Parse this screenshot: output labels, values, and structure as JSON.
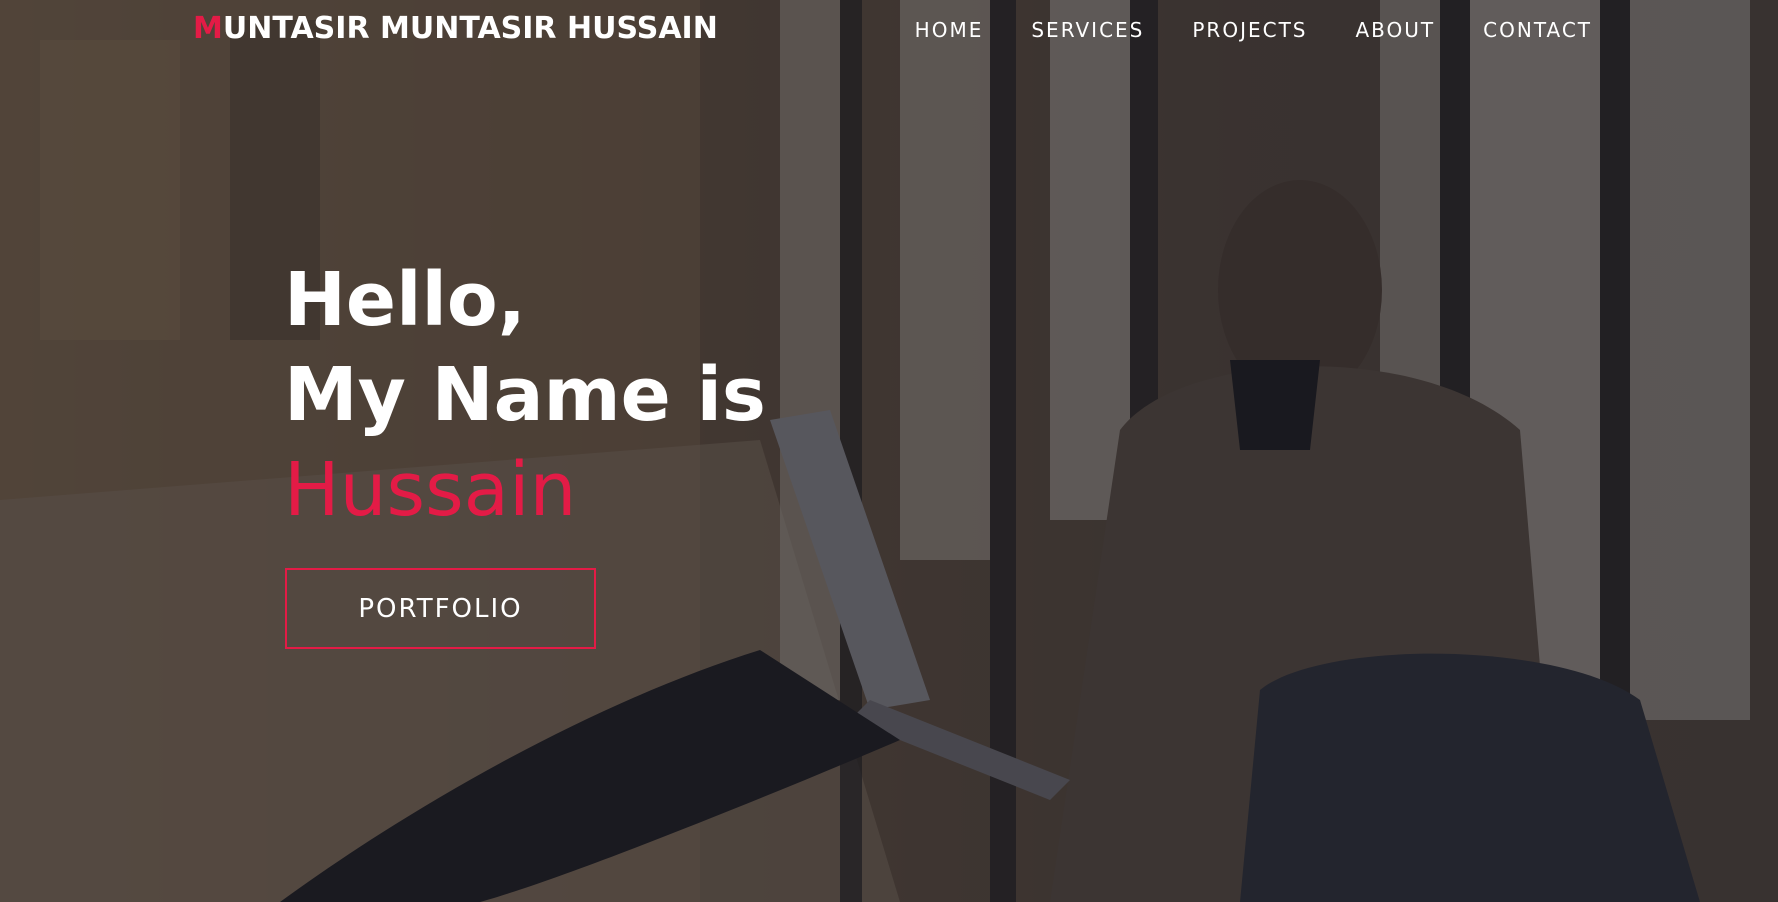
{
  "brand": {
    "first_letter": "M",
    "rest": "UNTASIR MUNTASIR HUSSAIN"
  },
  "nav": {
    "items": [
      {
        "label": "HOME"
      },
      {
        "label": "SERVICES"
      },
      {
        "label": "PROJECTS"
      },
      {
        "label": "ABOUT"
      },
      {
        "label": "CONTACT"
      }
    ]
  },
  "hero": {
    "line1": "Hello,",
    "line2": "My Name is",
    "line3": "Hussain",
    "button_label": "PORTFOLIO"
  },
  "colors": {
    "accent": "#e31b46",
    "text": "#ffffff",
    "overlay": "#1e1e28"
  }
}
